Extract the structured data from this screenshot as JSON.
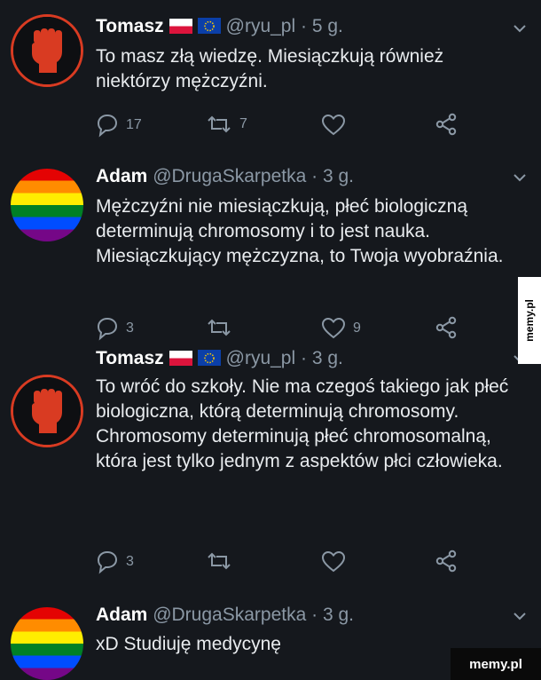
{
  "tweets": [
    {
      "name": "Tomasz",
      "handle": "@ryu_pl",
      "time": "5 g.",
      "text": "To masz złą wiedzę. Miesiączkują również niektórzy mężczyźni.",
      "replies": "17",
      "retweets": "7",
      "likes": ""
    },
    {
      "name": "Adam",
      "handle": "@DrugaSkarpetka",
      "time": "3 g.",
      "text": "Mężczyźni nie miesiączkują, płeć biologiczną determinują chromosomy i to jest nauka. Miesiączkujący mężczyzna, to Twoja wyobraźnia.",
      "replies": "3",
      "retweets": "",
      "likes": "9"
    },
    {
      "name": "Tomasz",
      "handle": "@ryu_pl",
      "time": "3 g.",
      "text": "To wróć do szkoły. Nie ma czegoś takiego jak płeć biologiczna, którą determinują chromosomy. Chromosomy determinują płeć chromosomalną, która jest tylko jednym z aspektów płci człowieka.",
      "replies": "3",
      "retweets": "",
      "likes": ""
    },
    {
      "name": "Adam",
      "handle": "@DrugaSkarpetka",
      "time": "3 g.",
      "text": "xD Studiuję medycynę"
    }
  ],
  "separator": "·",
  "watermark_side": "memy.pl",
  "watermark_corner": "memy.pl",
  "colors": {
    "background": "#15181d",
    "muted": "#8b98a5",
    "text": "#e9ecef",
    "fist": "#d93b22"
  },
  "icons": [
    "reply-icon",
    "retweet-icon",
    "like-icon",
    "share-icon",
    "chevron-down-icon",
    "flag-pl-icon",
    "flag-eu-icon"
  ]
}
